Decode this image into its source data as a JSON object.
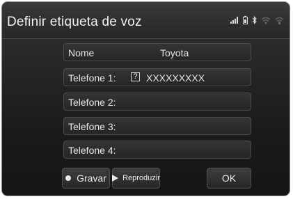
{
  "screen": {
    "title": "Definir etiqueta de voz"
  },
  "rows": [
    {
      "label": "Nome",
      "value": "Toyota"
    },
    {
      "label": "Telefone 1:",
      "icon_text": "?",
      "value": "XXXXXXXXX"
    },
    {
      "label": "Telefone 2:",
      "value": ""
    },
    {
      "label": "Telefone 3:",
      "value": ""
    },
    {
      "label": "Telefone 4:",
      "value": ""
    }
  ],
  "buttons": {
    "record": "Gravar",
    "play": "Reproduzir",
    "ok": "OK"
  },
  "status_icons": [
    "signal-bars-icon",
    "battery-icon",
    "bluetooth-icon",
    "wifi-icon",
    "hotspot-icon"
  ],
  "colors": {
    "background": "#1b1b1b",
    "text": "#e6e6e6",
    "border": "#4d4d4d"
  }
}
